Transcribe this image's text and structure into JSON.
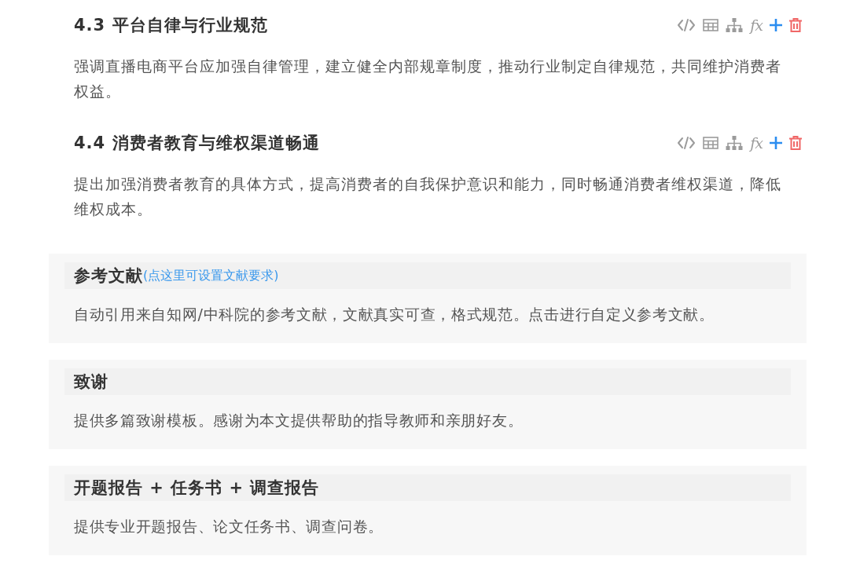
{
  "sections": [
    {
      "heading": "4.3 平台自律与行业规范",
      "toolbar": {
        "formula": "fx"
      },
      "text": "强调直播电商平台应加强自律管理，建立健全内部规章制度，推动行业制定自律规范，共同维护消费者权益。"
    },
    {
      "heading": "4.4 消费者教育与维权渠道畅通",
      "toolbar": {
        "formula": "fx"
      },
      "text": "提出加强消费者教育的具体方式，提高消费者的自我保护意识和能力，同时畅通消费者维权渠道，降低维权成本。"
    }
  ],
  "cards": [
    {
      "title": "参考文献",
      "link": "(点这里可设置文献要求)",
      "description": "自动引用来自知网/中科院的参考文献，文献真实可查，格式规范。点击进行自定义参考文献。"
    },
    {
      "title": "致谢",
      "description": "提供多篇致谢模板。感谢为本文提供帮助的指导教师和亲朋好友。"
    },
    {
      "title": "开题报告 + 任务书 + 调查报告",
      "description": "提供专业开题报告、论文任务书、调查问卷。"
    }
  ]
}
